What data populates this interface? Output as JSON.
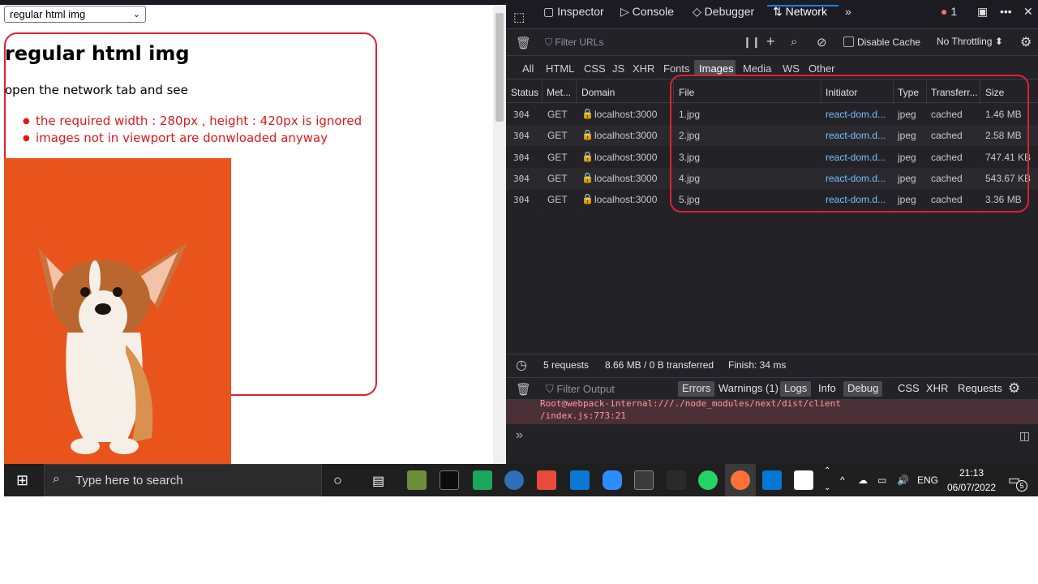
{
  "page": {
    "select_value": "regular html img",
    "heading": "regular html img",
    "paragraph": "open the network tab and see",
    "bullets": [
      "the required width : 280px , height : 420px is ignored",
      "images not in viewport are donwloaded anyway"
    ]
  },
  "devtools": {
    "tabs": [
      "Inspector",
      "Console",
      "Debugger",
      "Network"
    ],
    "active_tab": "Network",
    "error_count": "1",
    "filter_placeholder": "Filter URLs",
    "disable_cache": "Disable Cache",
    "throttling": "No Throttling",
    "type_filters": [
      "All",
      "HTML",
      "CSS",
      "JS",
      "XHR",
      "Fonts",
      "Images",
      "Media",
      "WS",
      "Other"
    ],
    "active_type": "Images",
    "columns": [
      "Status",
      "Met...",
      "Domain",
      "File",
      "Initiator",
      "Type",
      "Transferr...",
      "Size"
    ],
    "rows": [
      {
        "status": "304",
        "method": "GET",
        "domain": "localhost:3000",
        "file": "1.jpg",
        "initiator": "react-dom.d...",
        "type": "jpeg",
        "transferred": "cached",
        "size": "1.46 MB"
      },
      {
        "status": "304",
        "method": "GET",
        "domain": "localhost:3000",
        "file": "2.jpg",
        "initiator": "react-dom.d...",
        "type": "jpeg",
        "transferred": "cached",
        "size": "2.58 MB"
      },
      {
        "status": "304",
        "method": "GET",
        "domain": "localhost:3000",
        "file": "3.jpg",
        "initiator": "react-dom.d...",
        "type": "jpeg",
        "transferred": "cached",
        "size": "747.41 KB"
      },
      {
        "status": "304",
        "method": "GET",
        "domain": "localhost:3000",
        "file": "4.jpg",
        "initiator": "react-dom.d...",
        "type": "jpeg",
        "transferred": "cached",
        "size": "543.67 KB"
      },
      {
        "status": "304",
        "method": "GET",
        "domain": "localhost:3000",
        "file": "5.jpg",
        "initiator": "react-dom.d...",
        "type": "jpeg",
        "transferred": "cached",
        "size": "3.36 MB"
      }
    ],
    "summary": {
      "requests": "5 requests",
      "transferred": "8.66 MB / 0 B transferred",
      "finish": "Finish: 34 ms"
    },
    "console": {
      "filter_placeholder": "Filter Output",
      "levels": [
        "Errors",
        "Warnings (1)",
        "Logs",
        "Info",
        "Debug"
      ],
      "kinds": [
        "CSS",
        "XHR",
        "Requests"
      ],
      "error_line_1": "Root@webpack-internal:///./node_modules/next/dist/client",
      "error_line_2": "/index.js:773:21"
    }
  },
  "taskbar": {
    "search_placeholder": "Type here to search",
    "lang": "ENG",
    "time": "21:13",
    "date": "06/07/2022",
    "notifications": "5"
  },
  "colors": {
    "highlight_red": "#e02030",
    "bullet_red": "#e01818",
    "devtools_bg": "#232327",
    "link_blue": "#75bfff",
    "dog_bg": "#e9541d"
  }
}
